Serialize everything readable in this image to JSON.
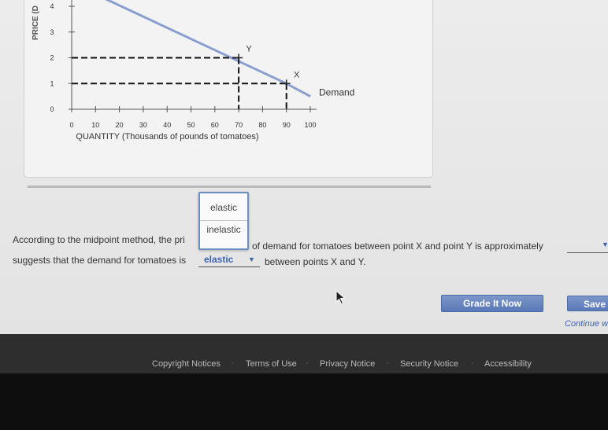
{
  "chart_data": {
    "type": "line",
    "series": [
      {
        "name": "Demand",
        "x": [
          0,
          90,
          100
        ],
        "y": [
          4.9,
          1.0,
          0.5
        ]
      }
    ],
    "points": [
      {
        "label": "Y",
        "x": 70,
        "y": 2
      },
      {
        "label": "X",
        "x": 90,
        "y": 1
      }
    ],
    "x_ticks": [
      0,
      10,
      20,
      30,
      40,
      50,
      60,
      70,
      80,
      90,
      100
    ],
    "y_ticks": [
      0,
      1,
      2,
      3,
      4
    ],
    "xlabel": "QUANTITY (Thousands of pounds of tomatoes)",
    "ylabel": "PRICE (D",
    "xlim": [
      0,
      100
    ],
    "ylim": [
      0,
      4
    ],
    "grid": false,
    "line_color": "#8a9fd0",
    "guide_color": "#111111"
  },
  "dropdown": {
    "options": [
      "elastic",
      "inelastic"
    ]
  },
  "question": {
    "line1_before": "According to the midpoint method, the pri",
    "line1_after": "of demand for tomatoes between point X and point Y is approximately",
    "line2_before": "suggests that the demand for tomatoes is",
    "selected_value": "elastic",
    "line2_after": "between points X and Y."
  },
  "buttons": {
    "grade": "Grade It Now",
    "save": "Save i",
    "continue": "Continue w"
  },
  "footer": {
    "links": [
      "Copyright Notices",
      "Terms of Use",
      "Privacy Notice",
      "Security Notice",
      "Accessibility"
    ]
  },
  "colors": {
    "accent": "#5a78b6",
    "link": "#3b63b5",
    "footer_bg": "#2e2e2e"
  }
}
